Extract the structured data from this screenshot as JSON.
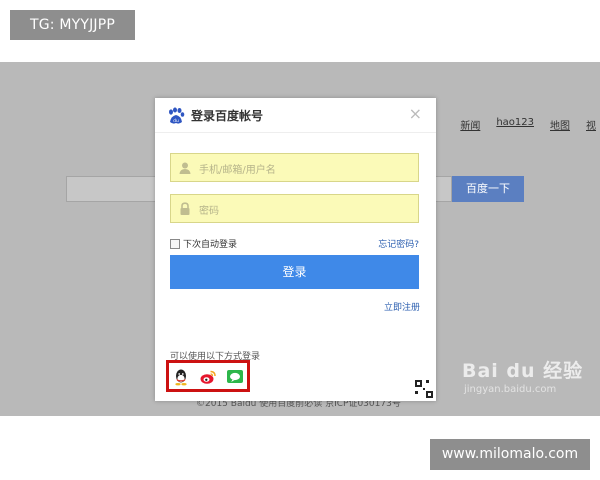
{
  "overlay": {
    "top_tag": "TG: MYYJJPP",
    "bottom_tag": "www.milomalo.com"
  },
  "background_page": {
    "nav": [
      "新闻",
      "hao123",
      "地图",
      "视"
    ],
    "search_button": "百度一下",
    "footer": "©2015 Baidu 使用百度前必读 京ICP证030173号"
  },
  "dialog": {
    "title": "登录百度帐号",
    "close_label": "×",
    "username_placeholder": "手机/邮箱/用户名",
    "password_placeholder": "密码",
    "remember_label": "下次自动登录",
    "forgot_label": "忘记密码?",
    "login_button": "登录",
    "register_link": "立即注册",
    "other_methods_label": "可以使用以下方式登录",
    "social_icons": [
      "qq-icon",
      "weibo-icon",
      "wechat-icon"
    ]
  },
  "watermark": {
    "main": "Bai du 经验",
    "sub": "jingyan.baidu.com"
  },
  "colors": {
    "screen_bg": "#b9b9b9",
    "login_button": "#3f89e8",
    "input_bg": "#fbfab8",
    "highlight_border": "#cc1111",
    "link": "#2c5fb0"
  }
}
